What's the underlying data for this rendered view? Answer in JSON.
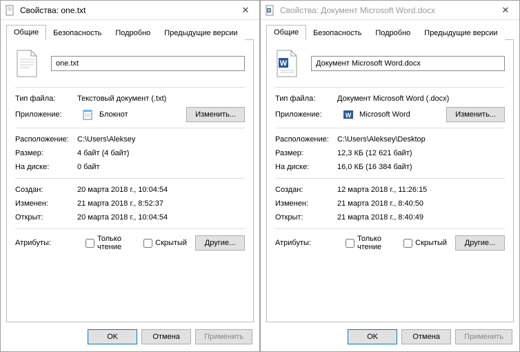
{
  "left": {
    "title": "Свойства: one.txt",
    "tabs": [
      "Общие",
      "Безопасность",
      "Подробно",
      "Предыдущие версии"
    ],
    "filename": "one.txt",
    "filetype_label": "Тип файла:",
    "filetype": "Текстовый документ (.txt)",
    "app_label": "Приложение:",
    "app": "Блокнот",
    "change_btn": "Изменить...",
    "location_label": "Расположение:",
    "location": "C:\\Users\\Aleksey",
    "size_label": "Размер:",
    "size": "4 байт (4 байт)",
    "ondisk_label": "На диске:",
    "ondisk": "0 байт",
    "created_label": "Создан:",
    "created": "20 марта 2018 г., 10:04:54",
    "modified_label": "Изменен:",
    "modified": "21 марта 2018 г., 8:52:37",
    "accessed_label": "Открыт:",
    "accessed": "20 марта 2018 г., 10:04:54",
    "attrib_label": "Атрибуты:",
    "readonly": "Только чтение",
    "hidden": "Скрытый",
    "other_btn": "Другие...",
    "ok": "OK",
    "cancel": "Отмена",
    "apply": "Применить"
  },
  "right": {
    "title": "Свойства: Документ Microsoft Word.docx",
    "tabs": [
      "Общие",
      "Безопасность",
      "Подробно",
      "Предыдущие версии"
    ],
    "filename": "Документ Microsoft Word.docx",
    "filetype_label": "Тип файла:",
    "filetype": "Документ Microsoft Word (.docx)",
    "app_label": "Приложение:",
    "app": "Microsoft Word",
    "change_btn": "Изменить...",
    "location_label": "Расположение:",
    "location": "C:\\Users\\Aleksey\\Desktop",
    "size_label": "Размер:",
    "size": "12,3 КБ (12 621 байт)",
    "ondisk_label": "На диске:",
    "ondisk": "16,0 КБ (16 384 байт)",
    "created_label": "Создан:",
    "created": "12 марта 2018 г., 11:26:15",
    "modified_label": "Изменен:",
    "modified": "21 марта 2018 г., 8:40:50",
    "accessed_label": "Открыт:",
    "accessed": "21 марта 2018 г., 8:40:49",
    "attrib_label": "Атрибуты:",
    "readonly": "Только чтение",
    "hidden": "Скрытый",
    "other_btn": "Другие...",
    "ok": "OK",
    "cancel": "Отмена",
    "apply": "Применить"
  }
}
